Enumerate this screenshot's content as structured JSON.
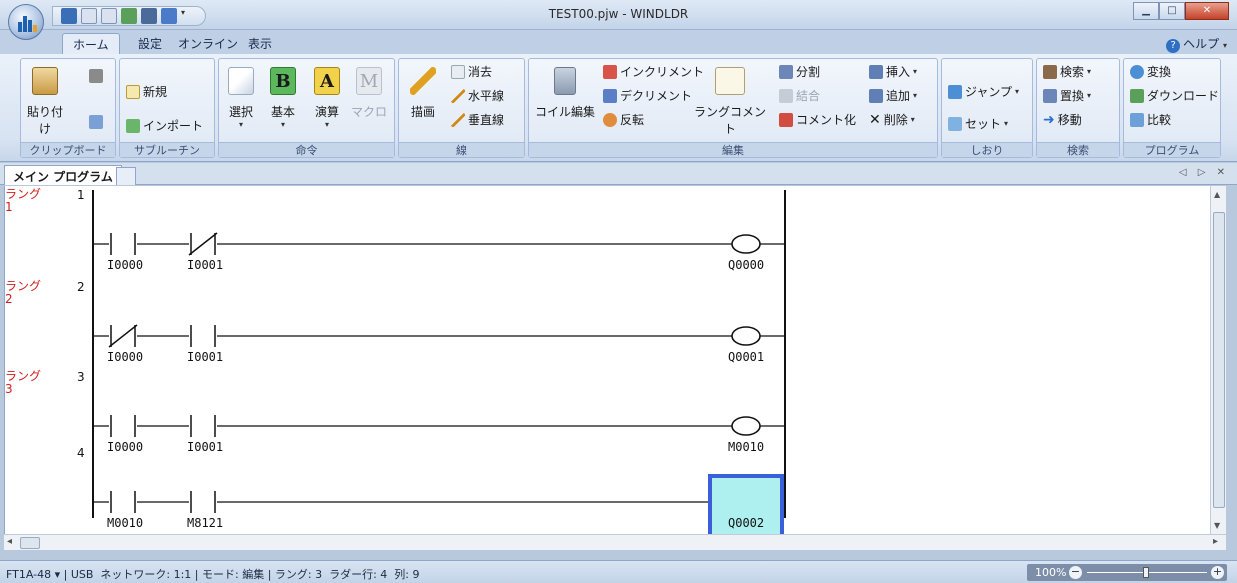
{
  "window": {
    "title": "TEST00.pjw - WINDLDR"
  },
  "tabs": [
    {
      "label": "ホーム",
      "active": true
    },
    {
      "label": "設定"
    },
    {
      "label": "オンライン"
    },
    {
      "label": "表示"
    }
  ],
  "help": {
    "label": "ヘルプ"
  },
  "ribbon": {
    "clipboard": {
      "label": "クリップボード",
      "paste": "貼り付け"
    },
    "subroutine": {
      "label": "サブルーチン",
      "new": "新規",
      "import": "インポート"
    },
    "instruction": {
      "label": "命令",
      "select": "選択",
      "basic": "基本",
      "operation": "演算",
      "macro": "マクロ"
    },
    "line": {
      "label": "線",
      "draw": "描画",
      "erase": "消去",
      "horizontal": "水平線",
      "vertical": "垂直線"
    },
    "edit": {
      "label": "編集",
      "coil_edit": "コイル編集",
      "increment": "インクリメント",
      "decrement": "デクリメント",
      "invert": "反転",
      "rung_comment": "ラングコメント",
      "split": "分割",
      "join": "結合",
      "to_comment": "コメント化",
      "insert": "挿入",
      "add": "追加",
      "delete": "削除"
    },
    "bookmark": {
      "label": "しおり",
      "jump": "ジャンプ",
      "set": "セット"
    },
    "search": {
      "label": "検索",
      "search": "検索",
      "replace": "置換",
      "move": "移動"
    },
    "program": {
      "label": "プログラム",
      "convert": "変換",
      "download": "ダウンロード",
      "compare": "比較"
    }
  },
  "doc_tab": {
    "label": "メイン プログラム"
  },
  "ladder": {
    "rungs": [
      {
        "label": "ラング",
        "label_num": "1",
        "num": "1",
        "ops": [
          "I0000",
          "I0001"
        ],
        "coil": "Q0000"
      },
      {
        "label": "ラング",
        "label_num": "2",
        "num": "2",
        "ops": [
          "I0000",
          "I0001"
        ],
        "coil": "Q0001"
      },
      {
        "label": "ラング",
        "label_num": "3",
        "num": "3",
        "ops": [
          "I0000",
          "I0001"
        ],
        "coil": "M0010"
      },
      {
        "label": "",
        "label_num": "",
        "num": "4",
        "ops": [
          "M0010",
          "M8121"
        ],
        "coil": "Q0002",
        "selected": true
      }
    ]
  },
  "status": {
    "text": "FT1A-48 ▾ | USB  ネットワーク: 1:1 | モード: 編集 | ラング: 3  ラダー行: 4  列: 9",
    "zoom": "100%"
  }
}
